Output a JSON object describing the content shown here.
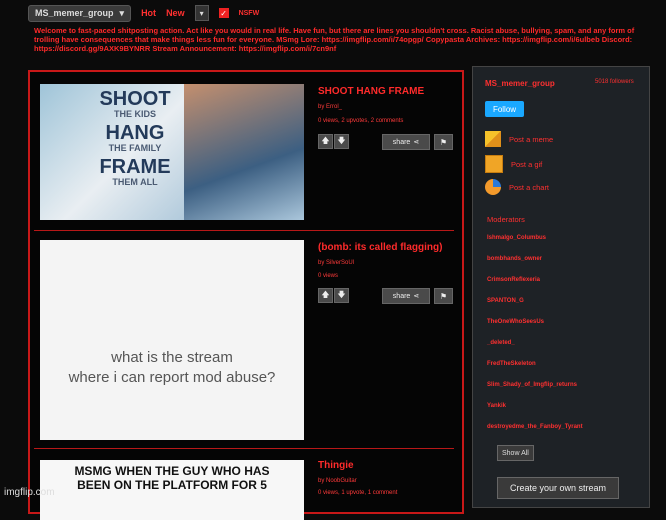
{
  "topbar": {
    "stream": "MS_memer_group",
    "tabs": [
      "Hot",
      "New"
    ],
    "nsfw_label": "NSFW"
  },
  "description": "Welcome to fast-paced shitposting action. Act like you would in real life. Have fun, but there are lines you shouldn't cross. Racist abuse, bullying, spam, and any form of trolling have consequences that make things less fun for everyone. MSmg Lore: https://imgflip.com/i/74opgp/ Copypasta Archives: https://imgflip.com/i/6ulbeb Discord: https://discord.gg/9AXK9BYNRR Stream Announcement: https://imgflip.com/i/7cn9nf",
  "posts": [
    {
      "title": "SHOOT HANG FRAME",
      "by": "by Errol_",
      "stats": "0 views, 2 upvotes, 2 comments",
      "meme_text": [
        "SHOOT",
        "THE KIDS",
        "HANG",
        "THE FAMILY",
        "FRAME",
        "THEM ALL"
      ],
      "share": "share"
    },
    {
      "title": "(bomb: its called flagging)",
      "by": "by SilverSoUl",
      "stats": "0 views",
      "meme_text": [
        "what is the stream",
        "where i can report mod abuse?"
      ],
      "share": "share"
    },
    {
      "title": "Thingie",
      "by": "by NoobGuitar",
      "stats": "0 views, 1 upvote, 1 comment",
      "meme_text": [
        "MSMG WHEN THE GUY WHO HAS",
        "BEEN ON THE PLATFORM FOR 5"
      ]
    }
  ],
  "sidebar": {
    "title": "MS_memer_group",
    "followers": "5018 followers",
    "follow": "Follow",
    "links": [
      {
        "label": "Post a meme",
        "icon": "meme-icon"
      },
      {
        "label": "Post a gif",
        "icon": "gif-icon"
      },
      {
        "label": "Post a chart",
        "icon": "chart-icon"
      }
    ],
    "mods_title": "Moderators",
    "mods": [
      "Ishmalgo_Columbus",
      "bombhands_owner",
      "CrimsonReflexeria",
      "SPANTON_G",
      "TheOneWhoSeesUs",
      "_deleted_",
      "FredTheSkeleton",
      "Slim_Shady_of_Imgflip_returns",
      "Yankik",
      "destroyedme_the_Fanboy_Tyrant"
    ],
    "show_all": "Show All",
    "create_stream": "Create your own stream"
  },
  "watermark": "imgflip.com"
}
